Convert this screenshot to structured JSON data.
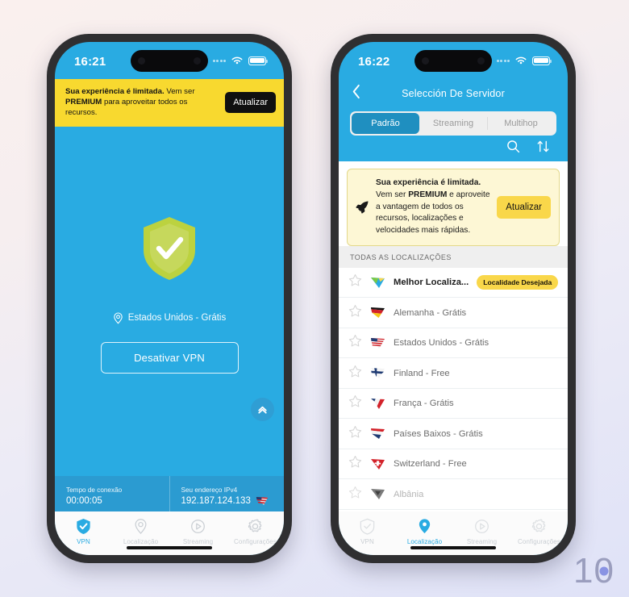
{
  "watermark": {
    "text_1": "1",
    "text_0": "0"
  },
  "colors": {
    "brand_blue": "#29abe2",
    "stats_blue": "#2b9bd1",
    "banner_yellow": "#f8d92f",
    "card_yellow": "#fdf7d5",
    "badge_yellow": "#f9d74a",
    "tab_active": "#1f8fc0",
    "shield_green": "#b5cf3f"
  },
  "left_phone": {
    "status": {
      "clock": "16:21"
    },
    "promo": {
      "bold": "Sua experiência é limitada.",
      "mid": " Vem ser ",
      "bold2": "PREMIUM",
      "rest": " para aproveitar todos os recursos.",
      "button": "Atualizar"
    },
    "location": "Estados Unidos - Grátis",
    "disconnect_button": "Desativar VPN",
    "stats": {
      "time_label": "Tempo de conexão",
      "time_value": "00:00:05",
      "ip_label": "Seu endereço IPv4",
      "ip_value": "192.187.124.133"
    },
    "tabs": [
      {
        "label": "VPN",
        "icon": "shield-icon",
        "active": true
      },
      {
        "label": "Localização",
        "icon": "location-pin-icon",
        "active": false
      },
      {
        "label": "Streaming",
        "icon": "play-circle-icon",
        "active": false
      },
      {
        "label": "Configurações",
        "icon": "gear-icon",
        "active": false
      }
    ]
  },
  "right_phone": {
    "status": {
      "clock": "16:22"
    },
    "nav_title": "Selección De Servidor",
    "segments": [
      {
        "label": "Padrão",
        "active": true
      },
      {
        "label": "Streaming",
        "active": false
      },
      {
        "label": "Multihop",
        "active": false
      }
    ],
    "promo": {
      "bold": "Sua experiência é limitada.",
      "mid": " Vem ser ",
      "bold2": "PREMIUM",
      "rest": " e aproveite a vantagem de todos os recursos, localizações e velocidades mais rápidas.",
      "button": "Atualizar"
    },
    "section_header": "TODAS AS LOCALIZAÇÕES",
    "servers": [
      {
        "name": "Melhor Localiza...",
        "flag": "best-location-icon",
        "badge": "Localidade Desejada",
        "best": true,
        "pin": true
      },
      {
        "name": "Alemanha - Grátis",
        "flag": "germany-flag"
      },
      {
        "name": "Estados Unidos - Grátis",
        "flag": "usa-flag"
      },
      {
        "name": "Finland - Free",
        "flag": "finland-flag"
      },
      {
        "name": "França - Grátis",
        "flag": "france-flag"
      },
      {
        "name": "Países Baixos - Grátis",
        "flag": "netherlands-flag"
      },
      {
        "name": "Switzerland - Free",
        "flag": "switzerland-flag"
      },
      {
        "name": "Albânia",
        "flag": "albania-flag",
        "dim": true
      }
    ],
    "tabs": [
      {
        "label": "VPN",
        "icon": "shield-icon",
        "active": false
      },
      {
        "label": "Localização",
        "icon": "location-pin-icon",
        "active": true
      },
      {
        "label": "Streaming",
        "icon": "play-circle-icon",
        "active": false
      },
      {
        "label": "Configurações",
        "icon": "gear-icon",
        "active": false
      }
    ]
  }
}
